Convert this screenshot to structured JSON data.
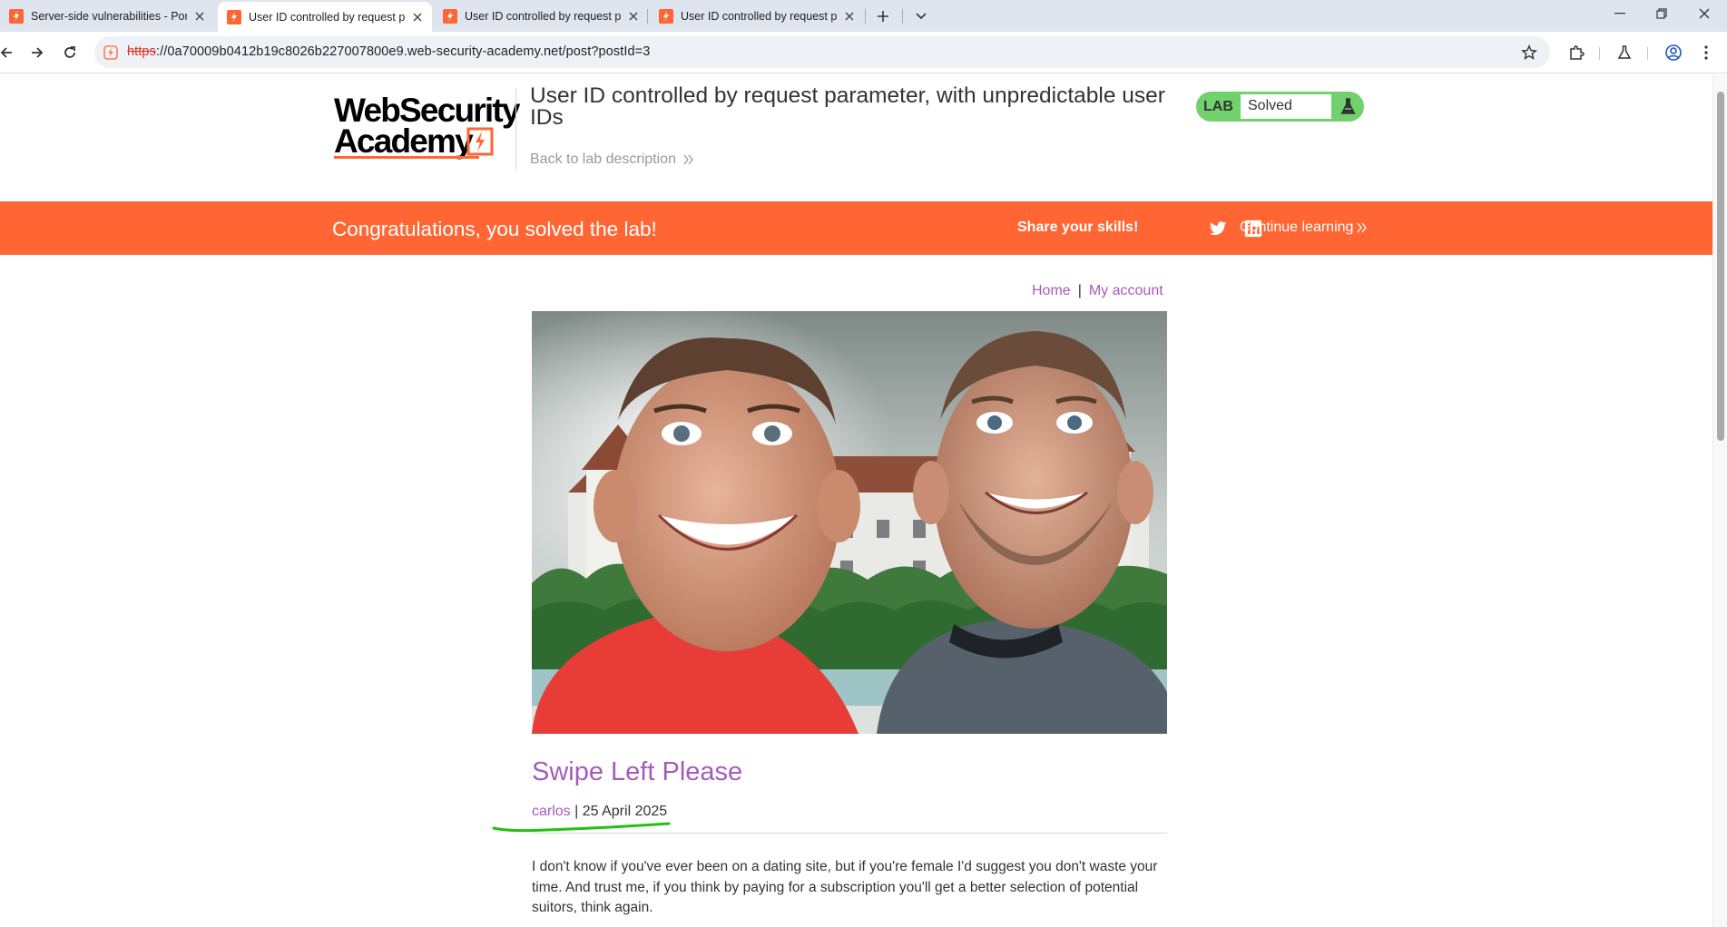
{
  "browser": {
    "tabs": [
      {
        "title": "Server-side vulnerabilities - Por",
        "active": false
      },
      {
        "title": "User ID controlled by request p",
        "active": true
      },
      {
        "title": "User ID controlled by request p",
        "active": false
      },
      {
        "title": "User ID controlled by request p",
        "active": false
      }
    ],
    "url": {
      "scheme": "https",
      "rest": "://0a70009b0412b19c8026b227007800e9.web-security-academy.net/post?postId=3"
    },
    "icons": [
      "back-icon",
      "forward-icon",
      "reload-icon",
      "bookmark-star-icon",
      "extensions-icon",
      "labs-flask-icon",
      "profile-icon",
      "menu-kebab-icon"
    ]
  },
  "page": {
    "logo": {
      "line1": "WebSecurity",
      "line2": "Academy"
    },
    "lab_title": "User ID controlled by request parameter, with unpredictable user IDs",
    "back_link": "Back to lab description",
    "lab_status": {
      "tag": "LAB",
      "value": "Solved"
    },
    "banner": {
      "message": "Congratulations, you solved the lab!",
      "share_label": "Share your skills!",
      "continue_label": "Continue learning"
    },
    "nav": {
      "home": "Home",
      "separator": "|",
      "account": "My account"
    },
    "post": {
      "title": "Swipe Left Please",
      "author": "carlos",
      "date_sep": "|",
      "date": "25 April 2025",
      "body": "I don't know if you've ever been on a dating site, but if you're female I'd suggest you don't waste your time. And trust me, if you think by paying for a subscription you'll get a better selection of potential suitors, think again."
    }
  },
  "colors": {
    "brand_orange": "#ff6633",
    "link_purple": "#a45cba",
    "lab_green": "#70d16d",
    "annotation_green": "#22c016"
  }
}
